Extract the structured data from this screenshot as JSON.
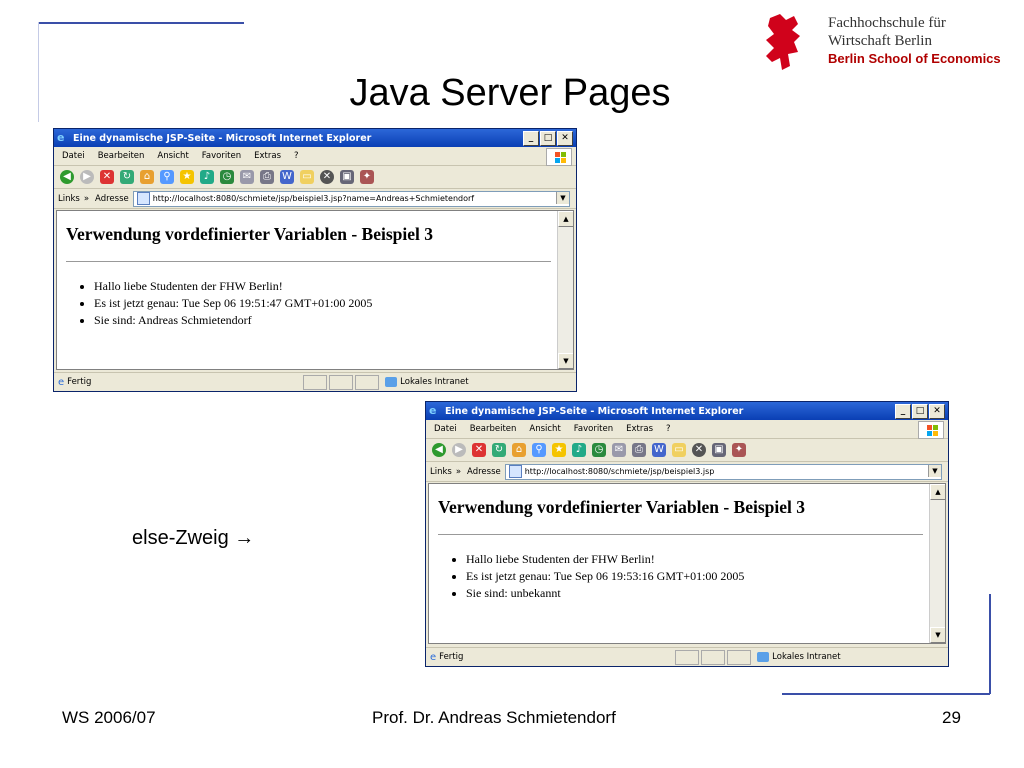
{
  "slide": {
    "title": "Java Server Pages",
    "else_label": "else-Zweig →",
    "footer_left": "WS 2006/07",
    "footer_center": "Prof. Dr. Andreas Schmietendorf",
    "footer_right": "29"
  },
  "logo": {
    "line1": "Fachhochschule für",
    "line2": "Wirtschaft Berlin",
    "line3": "Berlin School of Economics"
  },
  "browser": {
    "window_title": "Eine dynamische JSP-Seite - Microsoft Internet Explorer",
    "menu": [
      "Datei",
      "Bearbeiten",
      "Ansicht",
      "Favoriten",
      "Extras",
      "?"
    ],
    "links_label": "Links",
    "address_label": "Adresse",
    "status": "Fertig",
    "zone": "Lokales Intranet",
    "page_heading": "Verwendung vordefinierter Variablen - Beispiel 3"
  },
  "window1": {
    "url": "http://localhost:8080/schmiete/jsp/beispiel3.jsp?name=Andreas+Schmietendorf",
    "items": [
      "Hallo liebe Studenten der FHW Berlin!",
      "Es ist jetzt genau: Tue Sep 06 19:51:47 GMT+01:00 2005",
      "Sie sind: Andreas Schmietendorf"
    ]
  },
  "window2": {
    "url": "http://localhost:8080/schmiete/jsp/beispiel3.jsp",
    "items": [
      "Hallo liebe Studenten der FHW Berlin!",
      "Es ist jetzt genau: Tue Sep 06 19:53:16 GMT+01:00 2005",
      "Sie sind: unbekannt"
    ]
  }
}
